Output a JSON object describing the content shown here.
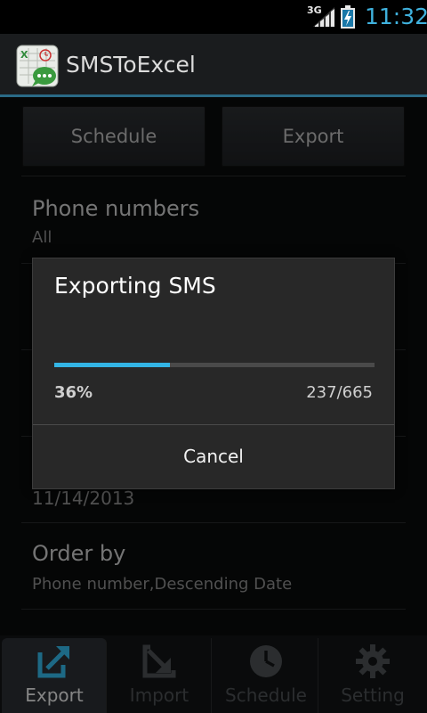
{
  "status_bar": {
    "network": "3G",
    "time": "11:32",
    "icons": [
      "signal-icon",
      "battery-charging-icon"
    ]
  },
  "action_bar": {
    "title": "SMSToExcel",
    "icon": "app-logo-icon"
  },
  "buttons": {
    "schedule": "Schedule",
    "export": "Export"
  },
  "rows": [
    {
      "title": "Phone numbers",
      "value": "All"
    },
    {
      "title": "",
      "value": "11/14/2013"
    },
    {
      "title": "Order by",
      "value": "Phone number,Descending Date"
    }
  ],
  "dialog": {
    "title": "Exporting SMS",
    "progress_percent_label": "36%",
    "progress_fraction": 0.36,
    "progress_count": "237/665",
    "cancel_label": "Cancel"
  },
  "tabs": [
    {
      "label": "Export",
      "icon": "export-arrow-icon",
      "active": true
    },
    {
      "label": "Import",
      "icon": "import-arrow-icon",
      "active": false
    },
    {
      "label": "Schedule",
      "icon": "clock-icon",
      "active": false
    },
    {
      "label": "Setting",
      "icon": "gear-icon",
      "active": false
    }
  ],
  "colors": {
    "accent": "#33b5e5",
    "time": "#3fb1dd",
    "actionbar_underline": "#2a6a86"
  }
}
